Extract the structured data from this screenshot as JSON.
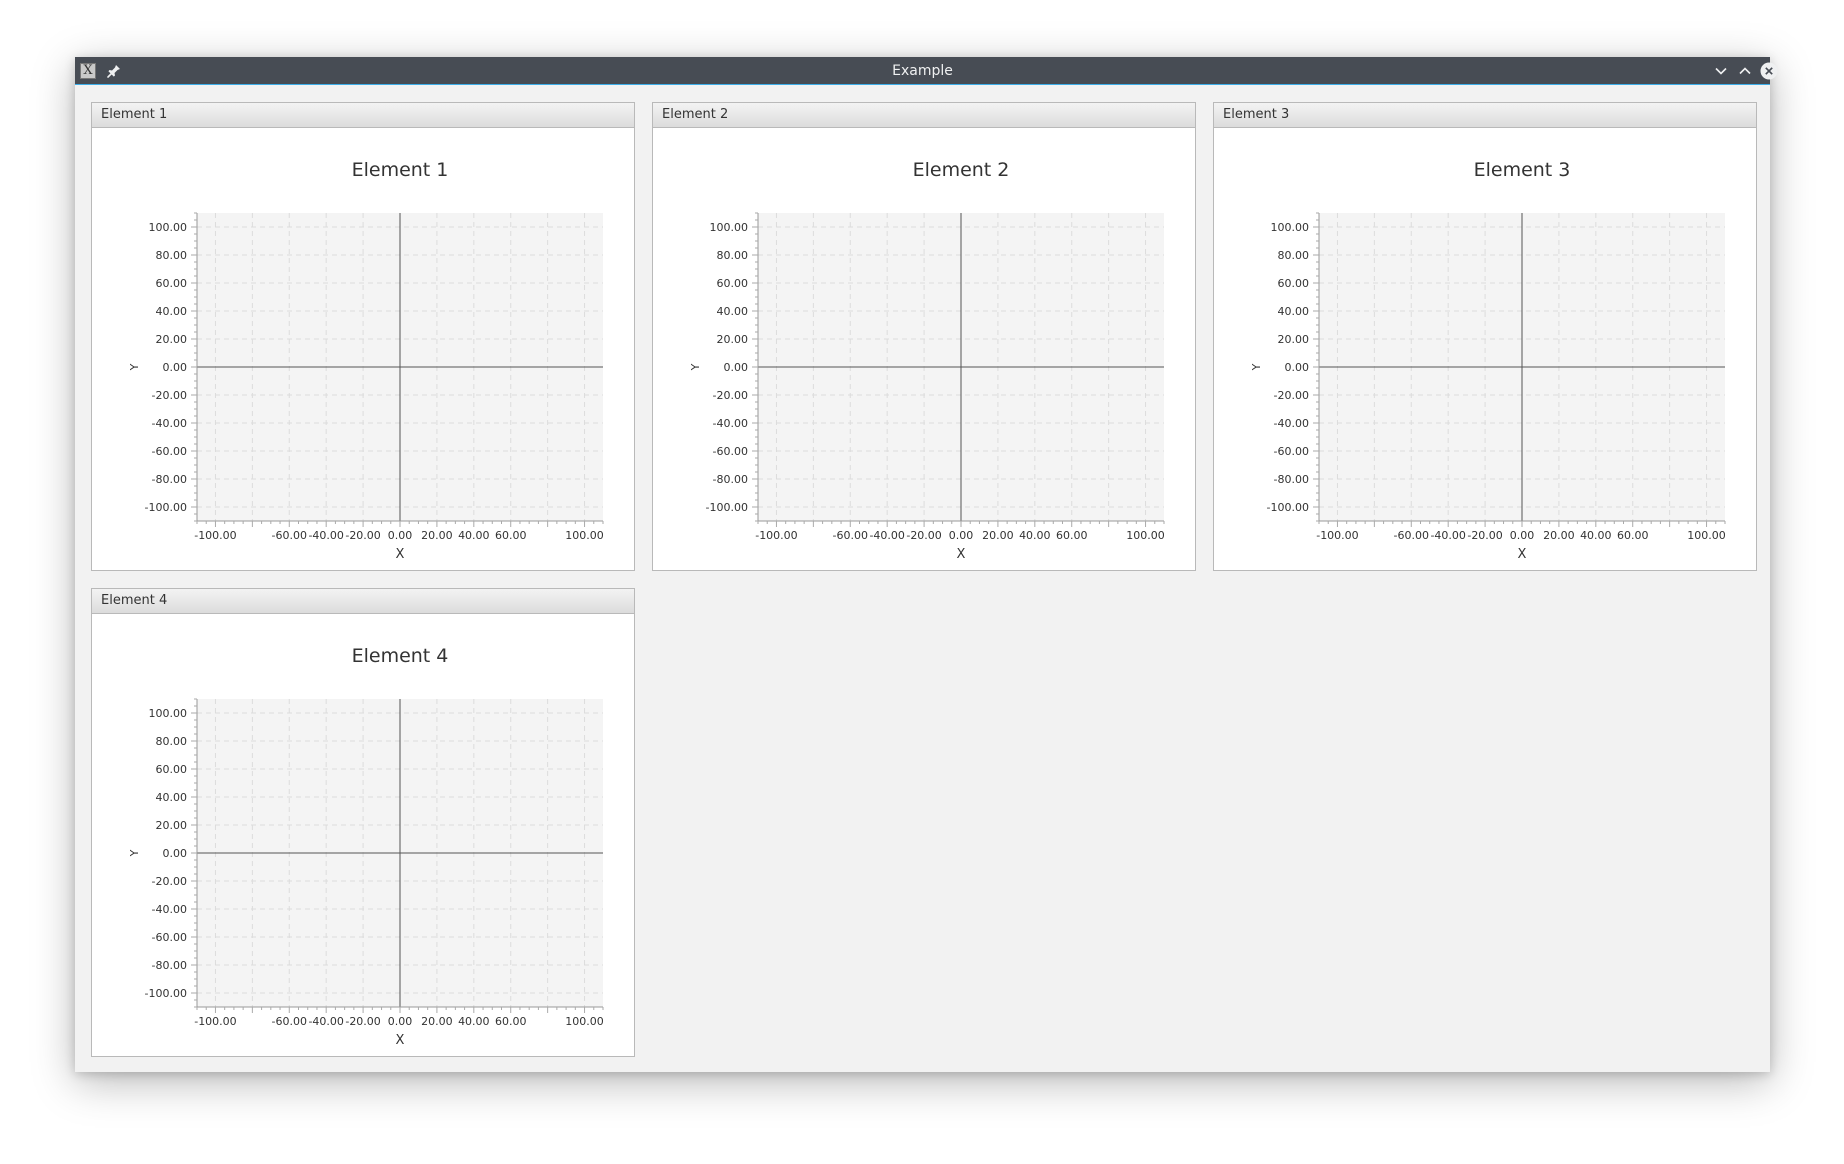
{
  "window": {
    "title": "Example",
    "app_icon_glyph": "X",
    "controls": [
      "minimize-icon",
      "maximize-icon",
      "close-icon"
    ]
  },
  "panels": [
    {
      "header": "Element 1",
      "chart_data": {
        "type": "line",
        "title": "Element 1",
        "xlabel": "X",
        "ylabel": "Y",
        "xlim": [
          -110,
          110
        ],
        "ylim": [
          -110,
          110
        ],
        "x_ticks": [
          "-100.00",
          "-60.00",
          "-40.00",
          "-20.00",
          "0.00",
          "20.00",
          "40.00",
          "60.00",
          "100.00"
        ],
        "y_ticks": [
          "100.00",
          "80.00",
          "60.00",
          "40.00",
          "20.00",
          "0.00",
          "-20.00",
          "-40.00",
          "-60.00",
          "-80.00",
          "-100.00"
        ],
        "series": [],
        "grid": true
      }
    },
    {
      "header": "Element 2",
      "chart_data": {
        "type": "line",
        "title": "Element 2",
        "xlabel": "X",
        "ylabel": "Y",
        "xlim": [
          -110,
          110
        ],
        "ylim": [
          -110,
          110
        ],
        "x_ticks": [
          "-100.00",
          "-60.00",
          "-40.00",
          "-20.00",
          "0.00",
          "20.00",
          "40.00",
          "60.00",
          "100.00"
        ],
        "y_ticks": [
          "100.00",
          "80.00",
          "60.00",
          "40.00",
          "20.00",
          "0.00",
          "-20.00",
          "-40.00",
          "-60.00",
          "-80.00",
          "-100.00"
        ],
        "series": [],
        "grid": true
      }
    },
    {
      "header": "Element 3",
      "chart_data": {
        "type": "line",
        "title": "Element 3",
        "xlabel": "X",
        "ylabel": "Y",
        "xlim": [
          -110,
          110
        ],
        "ylim": [
          -110,
          110
        ],
        "x_ticks": [
          "-100.00",
          "-60.00",
          "-40.00",
          "-20.00",
          "0.00",
          "20.00",
          "40.00",
          "60.00",
          "100.00"
        ],
        "y_ticks": [
          "100.00",
          "80.00",
          "60.00",
          "40.00",
          "20.00",
          "0.00",
          "-20.00",
          "-40.00",
          "-60.00",
          "-80.00",
          "-100.00"
        ],
        "series": [],
        "grid": true
      }
    },
    {
      "header": "Element 4",
      "chart_data": {
        "type": "line",
        "title": "Element 4",
        "xlabel": "X",
        "ylabel": "Y",
        "xlim": [
          -110,
          110
        ],
        "ylim": [
          -110,
          110
        ],
        "x_ticks": [
          "-100.00",
          "-60.00",
          "-40.00",
          "-20.00",
          "0.00",
          "20.00",
          "40.00",
          "60.00",
          "100.00"
        ],
        "y_ticks": [
          "100.00",
          "80.00",
          "60.00",
          "40.00",
          "20.00",
          "0.00",
          "-20.00",
          "-40.00",
          "-60.00",
          "-80.00",
          "-100.00"
        ],
        "series": [],
        "grid": true
      }
    }
  ],
  "colors": {
    "titlebar": "#474c54",
    "titlebar_accent": "#3daee9",
    "plot_background": "#f4f4f4",
    "grid": "#dcdcdc",
    "axis": "#333333"
  }
}
